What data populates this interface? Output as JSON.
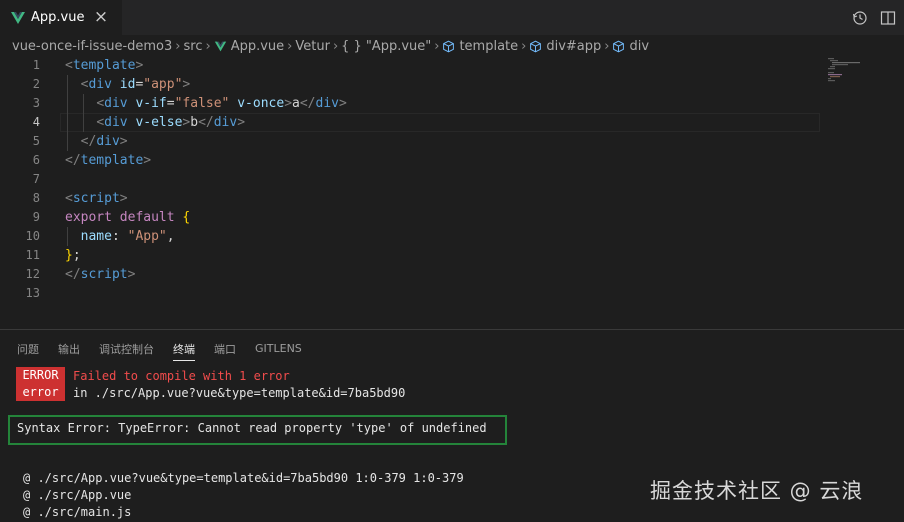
{
  "tab": {
    "label": "App.vue"
  },
  "breadcrumb": {
    "items": [
      "vue-once-if-issue-demo3",
      "src",
      "App.vue",
      "Vetur",
      "\"App.vue\"",
      "template",
      "div#app",
      "div"
    ],
    "object_prefix": "{ }"
  },
  "editor": {
    "line_numbers": [
      "1",
      "2",
      "3",
      "4",
      "5",
      "6",
      "7",
      "8",
      "9",
      "10",
      "11",
      "12",
      "13"
    ],
    "lines": [
      {
        "indent": "",
        "tokens": [
          [
            "t-tag",
            "<"
          ],
          [
            "t-name",
            "template"
          ],
          [
            "t-tag",
            ">"
          ]
        ]
      },
      {
        "indent": "  ",
        "tokens": [
          [
            "t-tag",
            "<"
          ],
          [
            "t-name",
            "div"
          ],
          [
            "t-txt",
            " "
          ],
          [
            "t-attr",
            "id"
          ],
          [
            "t-txt",
            "="
          ],
          [
            "t-str",
            "\"app\""
          ],
          [
            "t-tag",
            ">"
          ]
        ]
      },
      {
        "indent": "    ",
        "tokens": [
          [
            "t-tag",
            "<"
          ],
          [
            "t-name",
            "div"
          ],
          [
            "t-txt",
            " "
          ],
          [
            "t-attr",
            "v-if"
          ],
          [
            "t-txt",
            "="
          ],
          [
            "t-str",
            "\"false\""
          ],
          [
            "t-txt",
            " "
          ],
          [
            "t-attr",
            "v-once"
          ],
          [
            "t-tag",
            ">"
          ],
          [
            "t-txt",
            "a"
          ],
          [
            "t-tag",
            "</"
          ],
          [
            "t-name",
            "div"
          ],
          [
            "t-tag",
            ">"
          ]
        ]
      },
      {
        "indent": "    ",
        "tokens": [
          [
            "t-tag",
            "<"
          ],
          [
            "t-name",
            "div"
          ],
          [
            "t-txt",
            " "
          ],
          [
            "t-attr",
            "v-else"
          ],
          [
            "t-tag",
            ">"
          ],
          [
            "t-txt",
            "b"
          ],
          [
            "t-tag",
            "</"
          ],
          [
            "t-name",
            "div"
          ],
          [
            "t-tag",
            ">"
          ]
        ]
      },
      {
        "indent": "  ",
        "tokens": [
          [
            "t-tag",
            "</"
          ],
          [
            "t-name",
            "div"
          ],
          [
            "t-tag",
            ">"
          ]
        ]
      },
      {
        "indent": "",
        "tokens": [
          [
            "t-tag",
            "</"
          ],
          [
            "t-name",
            "template"
          ],
          [
            "t-tag",
            ">"
          ]
        ]
      },
      {
        "indent": "",
        "tokens": []
      },
      {
        "indent": "",
        "tokens": [
          [
            "t-tag",
            "<"
          ],
          [
            "t-name",
            "script"
          ],
          [
            "t-tag",
            ">"
          ]
        ]
      },
      {
        "indent": "",
        "tokens": [
          [
            "t-kw",
            "export"
          ],
          [
            "t-txt",
            " "
          ],
          [
            "t-kw",
            "default"
          ],
          [
            "t-txt",
            " "
          ],
          [
            "t-br",
            "{"
          ]
        ]
      },
      {
        "indent": "  ",
        "tokens": [
          [
            "t-prop",
            "name"
          ],
          [
            "t-txt",
            ": "
          ],
          [
            "t-str",
            "\"App\""
          ],
          [
            "t-txt",
            ","
          ]
        ]
      },
      {
        "indent": "",
        "tokens": [
          [
            "t-br",
            "}"
          ],
          [
            "t-txt",
            ";"
          ]
        ]
      },
      {
        "indent": "",
        "tokens": [
          [
            "t-tag",
            "</"
          ],
          [
            "t-name",
            "script"
          ],
          [
            "t-tag",
            ">"
          ]
        ]
      },
      {
        "indent": "",
        "tokens": []
      }
    ]
  },
  "panel": {
    "tabs": [
      "问题",
      "输出",
      "调试控制台",
      "终端",
      "端口",
      "GITLENS"
    ],
    "active_tab": "终端",
    "badge": [
      "ERROR",
      "error"
    ],
    "error_title": "Failed to compile with 1 error",
    "error_location": "in ./src/App.vue?vue&type=template&id=7ba5bd90",
    "syntax_error": "Syntax Error: TypeError: Cannot read property 'type' of undefined",
    "trace": [
      "@ ./src/App.vue?vue&type=template&id=7ba5bd90 1:0-379 1:0-379",
      "@ ./src/App.vue",
      "@ ./src/main.js"
    ]
  },
  "watermark": "掘金技术社区 @ 云浪",
  "colors": {
    "error_red": "#cd3131",
    "highlight_green": "#24843a",
    "vue_green": "#41b883"
  }
}
